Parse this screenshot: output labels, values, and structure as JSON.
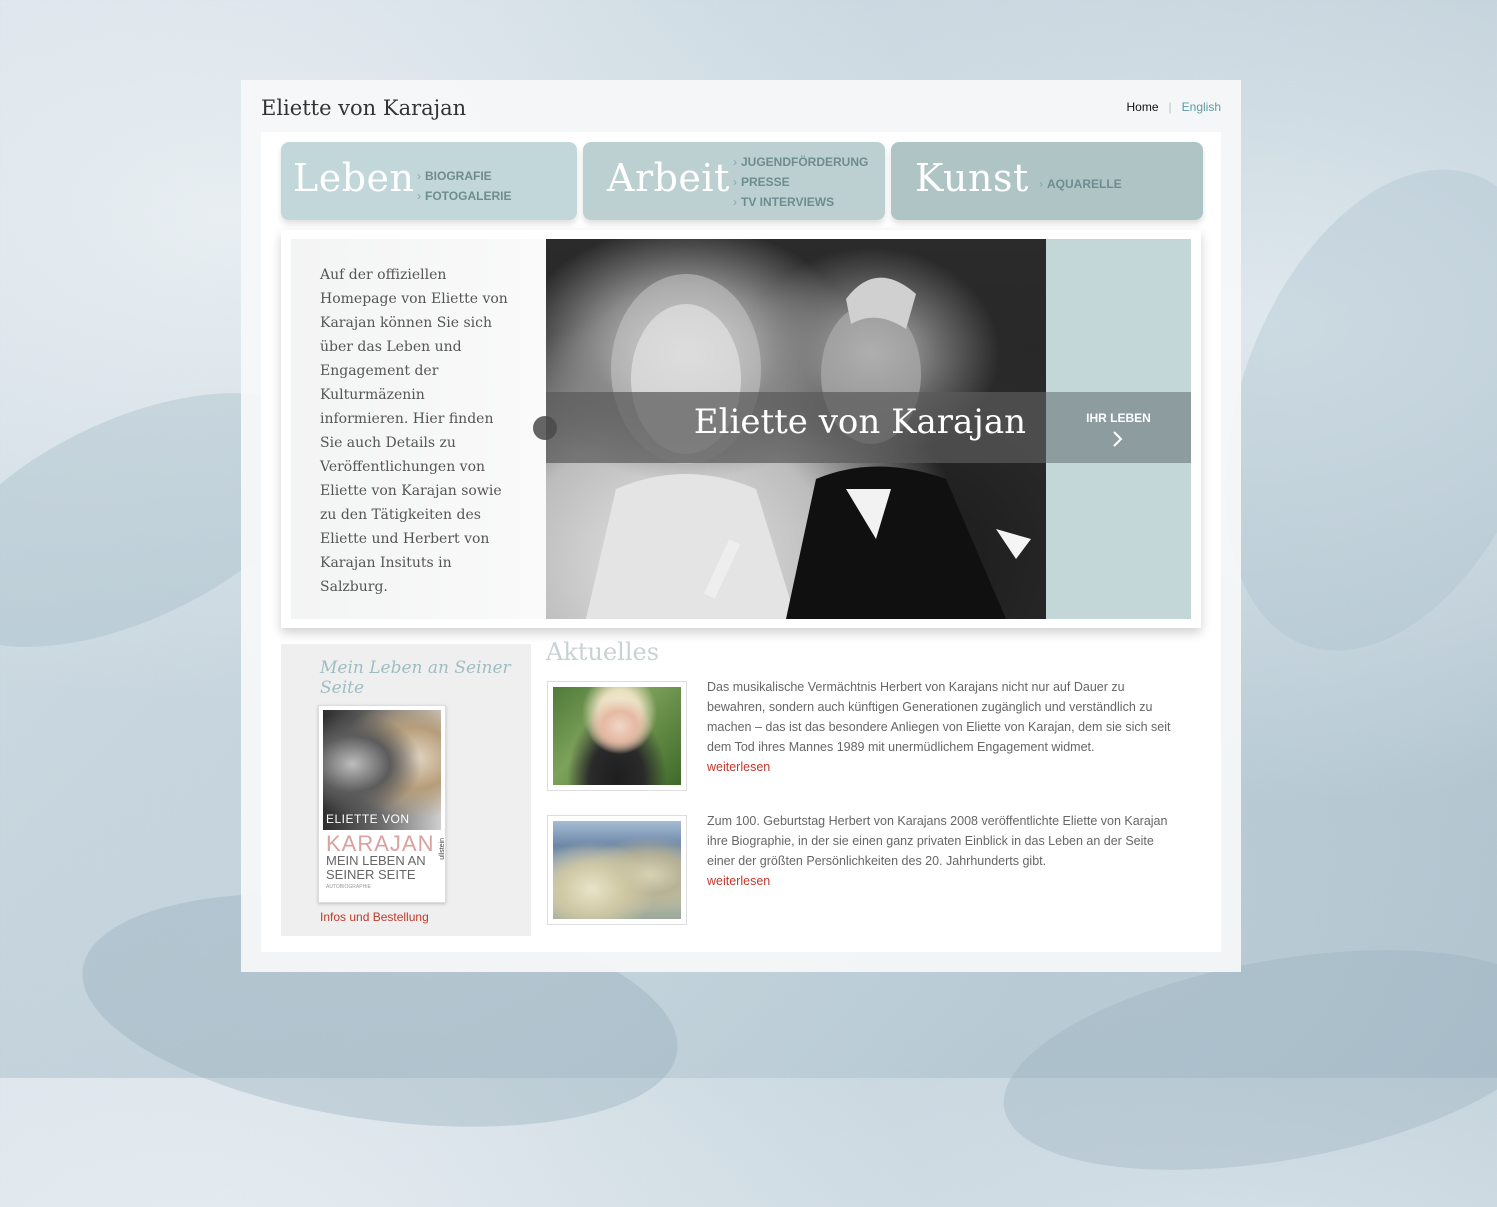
{
  "site": {
    "title": "Eliette von Karajan"
  },
  "lang": {
    "home": "Home",
    "separator": "|",
    "english": "English"
  },
  "nav": {
    "leben": {
      "label": "Leben",
      "items": [
        "BIOGRAFIE",
        "FOTOGALERIE"
      ]
    },
    "arbeit": {
      "label": "Arbeit",
      "items": [
        "JUGENDFÖRDERUNG",
        "PRESSE",
        "TV INTERVIEWS"
      ]
    },
    "kunst": {
      "label": "Kunst",
      "items": [
        "AQUARELLE"
      ]
    }
  },
  "intro": {
    "text": "Auf der offiziellen Homepage von Eliette von Karajan können Sie sich über das Leben und Engagement der Kulturmäzenin informieren. Hier finden Sie auch Details zu Veröffentlichungen von Eliette von Karajan sowie zu den Tätigkeiten des Eliette und Herbert von Karajan Insituts in Salzburg."
  },
  "hero": {
    "caption": "Eliette von Karajan",
    "cta": "IHR LEBEN"
  },
  "book": {
    "title": "Mein Leben an Seiner Seite",
    "cover_line1": "ELIETTE VON",
    "cover_line2": "KARAJAN",
    "cover_line3": "MEIN LEBEN AN",
    "cover_line4": "SEINER SEITE",
    "cover_line5": "AUTOBIOGRAPHIE",
    "cover_publisher": "ullstein",
    "link": "Infos und Bestellung"
  },
  "news": {
    "title": "Aktuelles",
    "items": [
      {
        "text": "Das musikalische Vermächtnis Herbert von Karajans nicht nur auf Dauer zu bewahren, sondern auch künftigen Generationen zugänglich und verständlich zu machen – das ist das besondere Anliegen von Eliette von Karajan, dem sie sich seit dem Tod ihres Mannes 1989 mit unermüdlichem Engagement widmet.",
        "more": "weiterlesen"
      },
      {
        "text": "Zum 100. Geburtstag Herbert von Karajans 2008 veröffentlichte Eliette von Karajan ihre Biographie, in der sie einen ganz privaten Einblick in das Leben an der Seite einer der größten Persönlichkeiten des 20. Jahrhunderts gibt.",
        "more": "weiterlesen"
      }
    ]
  },
  "colors": {
    "accent": "#5c9aa3",
    "link_red": "#c0392b",
    "nav_teal": "#c2d7d9"
  }
}
